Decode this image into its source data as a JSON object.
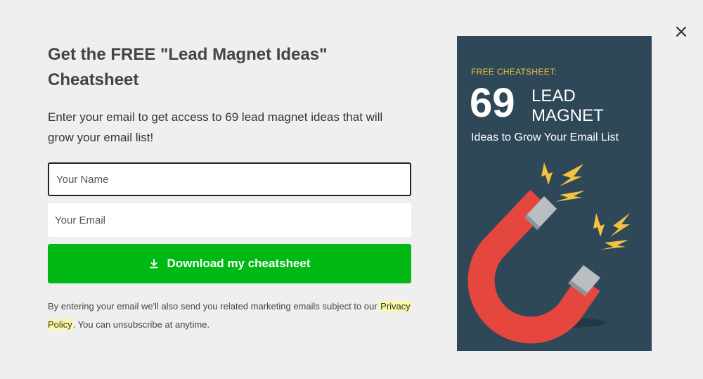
{
  "close": {
    "icon": "close-icon"
  },
  "form": {
    "title": "Get the FREE \"Lead Magnet Ideas\" Cheatsheet",
    "description": "Enter your email to get access to 69 lead magnet ideas that will grow your email list!",
    "name_placeholder": "Your Name",
    "email_placeholder": "Your Email",
    "button_label": "Download my cheatsheet",
    "button_icon": "download-icon",
    "button_color": "#00b915",
    "disclaimer_before": "By entering your email we'll also send you related marketing emails subject to our",
    "privacy_link": "Privacy Policy",
    "disclaimer_after": ". You can unsubscribe at anytime."
  },
  "cover": {
    "kicker": "FREE CHEATSHEET:",
    "number": "69",
    "line1": "LEAD",
    "line2": "MAGNET",
    "subtitle": "Ideas to Grow Your Email List",
    "background": "#2f4858",
    "accent": "#f1c240"
  }
}
